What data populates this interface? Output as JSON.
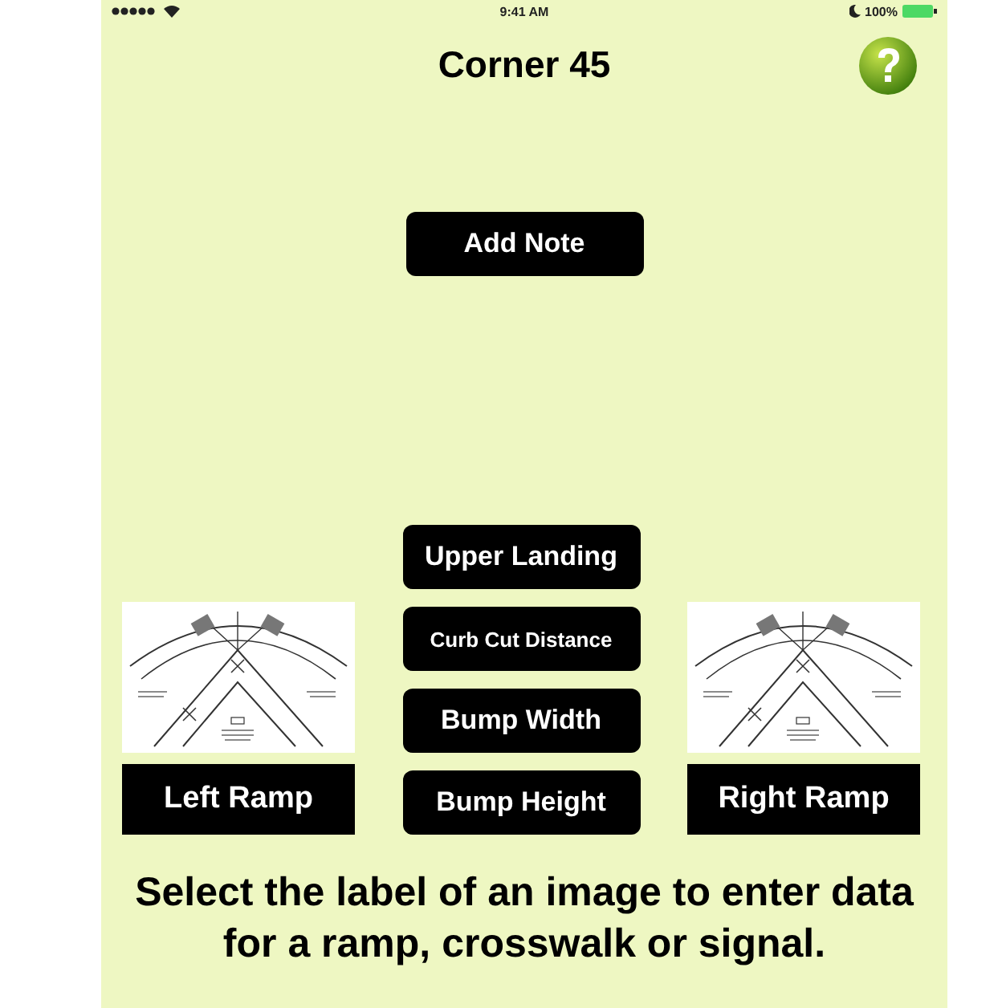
{
  "status_bar": {
    "time": "9:41 AM",
    "battery": "100%"
  },
  "title": "Corner 45",
  "add_note_button": "Add Note",
  "measurement_buttons": [
    "Upper Landing",
    "Curb Cut Distance",
    "Bump Width",
    "Bump Height"
  ],
  "ramps": [
    {
      "label": "Left Ramp"
    },
    {
      "label": "Right Ramp"
    }
  ],
  "instruction": "Select the label of an image to enter data for a ramp, crosswalk or signal."
}
